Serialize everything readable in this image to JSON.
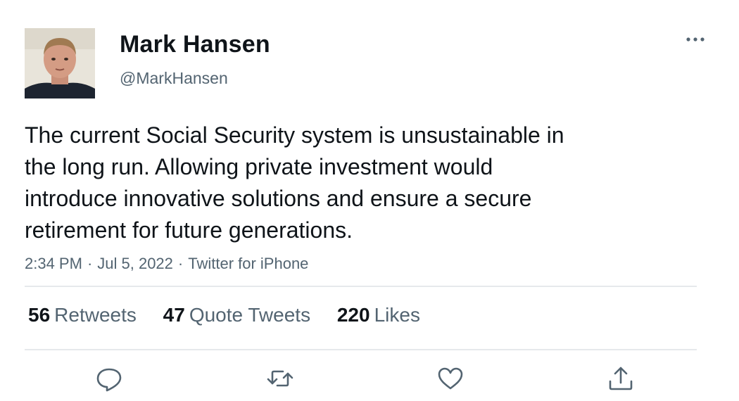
{
  "author": {
    "display_name": "Mark Hansen",
    "handle": "@MarkHansen",
    "avatar_icon": "profile-photo"
  },
  "tweet": {
    "lines": [
      "The current Social Security system is unsustainable in",
      "the long run. Allowing private investment would",
      "introduce innovative solutions and ensure a secure",
      "retirement for future generations."
    ],
    "time": "2:34 PM",
    "date": "Jul 5, 2022",
    "source": "Twitter for iPhone",
    "separator": "·"
  },
  "stats": {
    "retweets": {
      "count": "56",
      "label": "Retweets"
    },
    "quote_tweets": {
      "count": "47",
      "label": "Quote Tweets"
    },
    "likes": {
      "count": "220",
      "label": "Likes"
    }
  },
  "actions": [
    {
      "icon": "reply-icon"
    },
    {
      "icon": "retweet-icon"
    },
    {
      "icon": "like-icon"
    },
    {
      "icon": "share-icon"
    }
  ],
  "colors": {
    "text_primary": "#0f1419",
    "text_secondary": "#536471",
    "divider": "#e6e9ec"
  }
}
